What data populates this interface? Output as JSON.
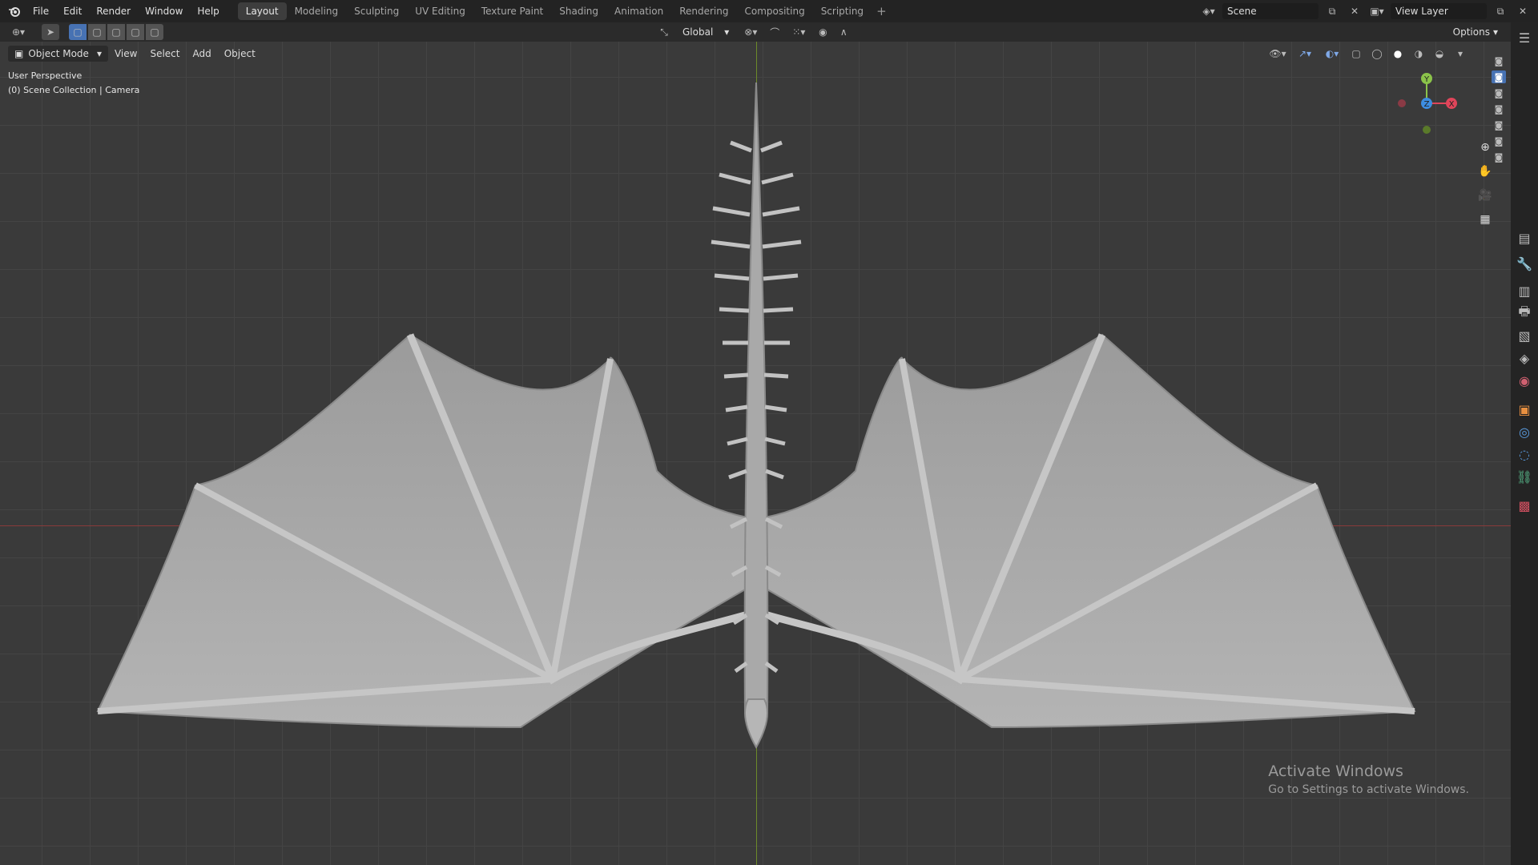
{
  "menu": [
    "File",
    "Edit",
    "Render",
    "Window",
    "Help"
  ],
  "workspaces": [
    {
      "label": "Layout",
      "active": true
    },
    {
      "label": "Modeling",
      "active": false
    },
    {
      "label": "Sculpting",
      "active": false
    },
    {
      "label": "UV Editing",
      "active": false
    },
    {
      "label": "Texture Paint",
      "active": false
    },
    {
      "label": "Shading",
      "active": false
    },
    {
      "label": "Animation",
      "active": false
    },
    {
      "label": "Rendering",
      "active": false
    },
    {
      "label": "Compositing",
      "active": false
    },
    {
      "label": "Scripting",
      "active": false
    }
  ],
  "scene": {
    "name": "Scene",
    "view_layer": "View Layer"
  },
  "viewport_header": {
    "mode": "Object Mode",
    "menu": [
      "View",
      "Select",
      "Add",
      "Object"
    ],
    "transform_orientation": "Global",
    "options_label": "Options"
  },
  "overlay": {
    "perspective": "User Perspective",
    "collection": "(0) Scene Collection | Camera"
  },
  "gizmo": {
    "x": "X",
    "y": "Y",
    "z": "Z"
  },
  "watermark": {
    "title": "Activate Windows",
    "subtitle": "Go to Settings to activate Windows."
  },
  "colors": {
    "accent": "#4772b3",
    "axis_x": "#8a3a3a",
    "axis_y": "#6d8a2a",
    "gizmo_x": "#e0455a",
    "gizmo_y": "#8bc34a",
    "gizmo_z": "#3d8de0"
  }
}
